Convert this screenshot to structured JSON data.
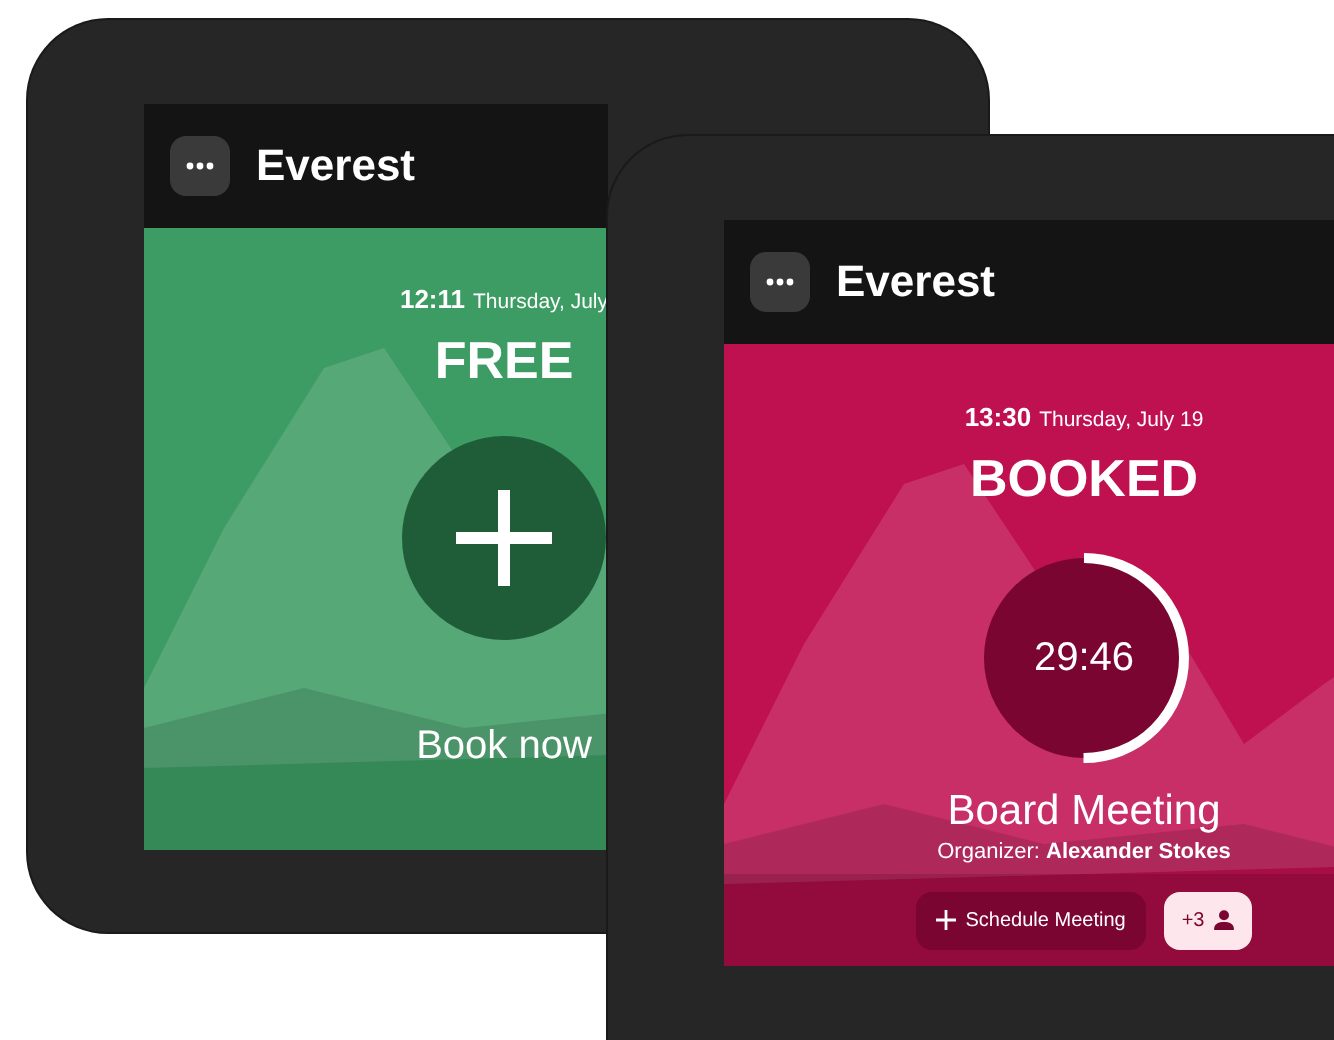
{
  "devices": [
    {
      "kind": "free",
      "header": {
        "title": "Everest"
      },
      "time": "12:11",
      "date": "Thursday, July",
      "state_label": "FREE",
      "action": "Book now"
    },
    {
      "kind": "booked",
      "header": {
        "title": "Everest"
      },
      "time": "13:30",
      "date": "Thursday, July 19",
      "state_label": "BOOKED",
      "countdown": {
        "text": "29:46",
        "level": 0.5
      },
      "meeting": {
        "title": "Board Meeting",
        "organizer": "Organizer: **Alexander Stokes**"
      },
      "schedule_button": "Schedule Meeting",
      "attendees": "+3"
    }
  ]
}
